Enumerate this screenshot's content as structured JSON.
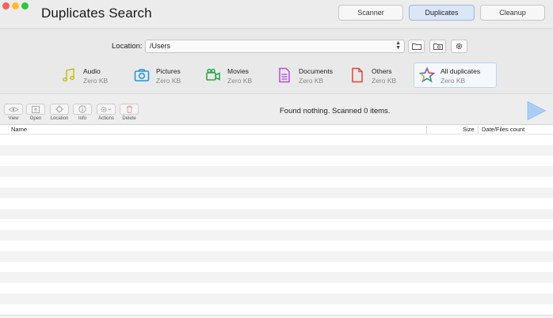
{
  "app": {
    "title": "Duplicates Search"
  },
  "tabs": [
    {
      "label": "Scanner"
    },
    {
      "label": "Duplicates"
    },
    {
      "label": "Cleanup"
    }
  ],
  "location": {
    "label": "Location:",
    "value": "/Users"
  },
  "categories": [
    {
      "name": "Audio",
      "size": "Zero KB",
      "icon": "music-note-icon",
      "color": "#c9bf1a"
    },
    {
      "name": "Pictures",
      "size": "Zero KB",
      "icon": "camera-icon",
      "color": "#1f9bd8"
    },
    {
      "name": "Movies",
      "size": "Zero KB",
      "icon": "video-camera-icon",
      "color": "#2aa84a"
    },
    {
      "name": "Documents",
      "size": "Zero KB",
      "icon": "document-icon",
      "color": "#b44fd8"
    },
    {
      "name": "Others",
      "size": "Zero KB",
      "icon": "file-icon",
      "color": "#e0453f"
    },
    {
      "name": "All duplicates",
      "size": "Zero KB",
      "icon": "star-icon",
      "color": "#3a5fcd"
    }
  ],
  "toolbar": {
    "view": "View",
    "open": "Open",
    "location": "Location",
    "info": "Info",
    "actions": "Actions",
    "delete": "Delete"
  },
  "status": "Found nothing. Scanned 0 items.",
  "table": {
    "columns": [
      "Name",
      "Size",
      "Date/Files count"
    ]
  }
}
